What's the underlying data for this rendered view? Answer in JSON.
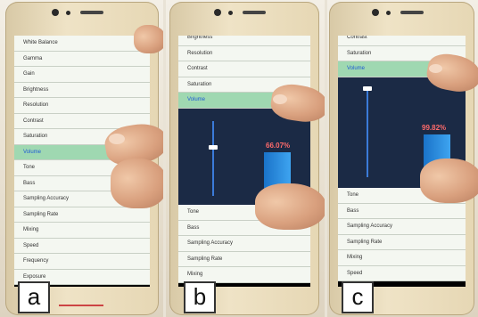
{
  "panels": [
    {
      "label": "a",
      "items": [
        "White Balance",
        "Gamma",
        "Gain",
        "Brightness",
        "Resolution",
        "Contrast",
        "Saturation",
        "Volume",
        "Tone",
        "Bass",
        "Sampling Accuracy",
        "Sampling Rate",
        "Mixing",
        "Speed",
        "Frequency",
        "Exposure"
      ],
      "selected": "Volume"
    },
    {
      "label": "b",
      "items_top": [
        "Brightness",
        "Resolution",
        "Contrast",
        "Saturation",
        "Volume"
      ],
      "items_bottom": [
        "Tone",
        "Bass",
        "Sampling Accuracy",
        "Sampling Rate",
        "Mixing"
      ],
      "selected": "Volume",
      "value_text": "66.07%",
      "level": 0.6607
    },
    {
      "label": "c",
      "items_top": [
        "Contrast",
        "Saturation",
        "Volume"
      ],
      "items_bottom": [
        "Tone",
        "Bass",
        "Sampling Accuracy",
        "Sampling Rate",
        "Mixing",
        "Speed"
      ],
      "selected": "Volume",
      "value_text": "99.82%",
      "level": 0.9982
    }
  ],
  "colors": {
    "selected_row": "#9fd8b1",
    "panel_bg": "#1b2a45",
    "bar": "#2b8de0",
    "value_text": "#ff6b6b"
  }
}
